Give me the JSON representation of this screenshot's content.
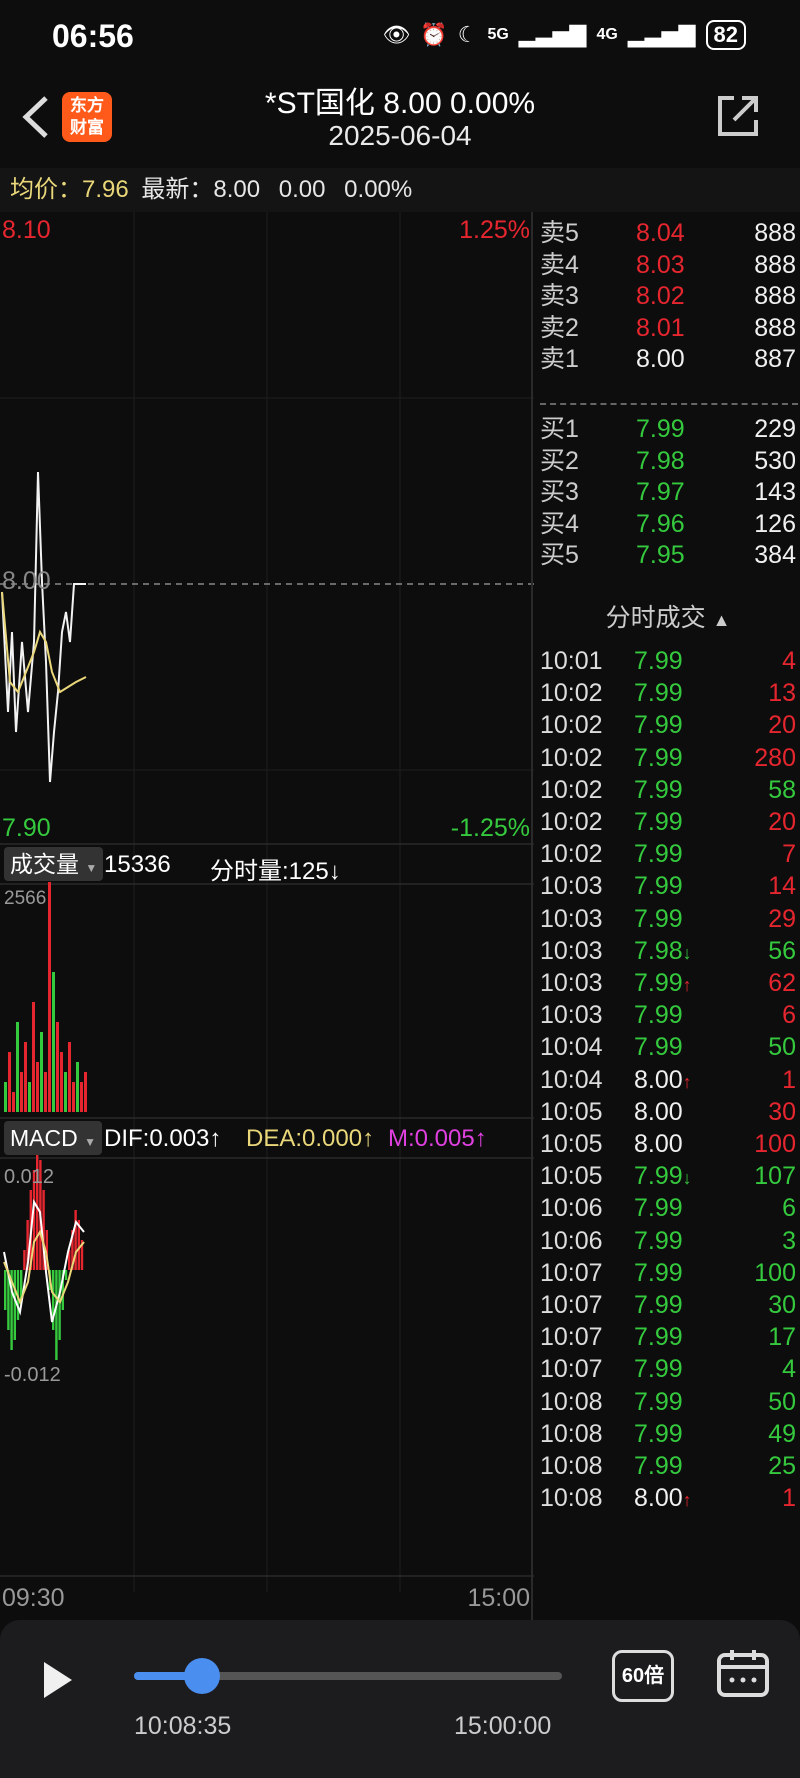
{
  "status_bar": {
    "time": "06:56",
    "net1": "5G",
    "net2": "4G",
    "battery": "82"
  },
  "header": {
    "title": "*ST国化  8.00  0.00%",
    "date": "2025-06-04",
    "logo_line1": "东方",
    "logo_line2": "财富"
  },
  "info": {
    "avg_label": "均价：",
    "avg_value": "7.96",
    "latest_label": "最新：",
    "latest_value": "8.00",
    "change": "0.00",
    "change_pct": "0.00%"
  },
  "chart": {
    "price_high": "8.10",
    "pct_high": "1.25%",
    "price_low": "7.90",
    "pct_low": "-1.25%",
    "price_ref": "8.00",
    "volume_dropdown": "成交量",
    "volume_total": "15336",
    "volume_minute": "分时量:125",
    "volume_max": "2566",
    "macd_dropdown": "MACD",
    "dif": "DIF:0.003",
    "dea": "DEA:0.000",
    "m": "M:0.005",
    "macd_max": "0.012",
    "macd_min": "-0.012",
    "time_start": "09:30",
    "time_end": "15:00",
    "colors": {
      "up": "#e6262f",
      "down": "#35c93e",
      "dif": "#ffffff",
      "dea": "#e9d77a",
      "m": "#e040e0"
    }
  },
  "order_book": {
    "asks": [
      {
        "label": "卖5",
        "price": "8.04",
        "volume": "888"
      },
      {
        "label": "卖4",
        "price": "8.03",
        "volume": "888"
      },
      {
        "label": "卖3",
        "price": "8.02",
        "volume": "888"
      },
      {
        "label": "卖2",
        "price": "8.01",
        "volume": "888"
      },
      {
        "label": "卖1",
        "price": "8.00",
        "volume": "887"
      }
    ],
    "bids": [
      {
        "label": "买1",
        "price": "7.99",
        "volume": "229"
      },
      {
        "label": "买2",
        "price": "7.98",
        "volume": "530"
      },
      {
        "label": "买3",
        "price": "7.97",
        "volume": "143"
      },
      {
        "label": "买4",
        "price": "7.96",
        "volume": "126"
      },
      {
        "label": "买5",
        "price": "7.95",
        "volume": "384"
      }
    ]
  },
  "ticks_title": "分时成交",
  "ticks": [
    {
      "time": "10:01",
      "price": "7.99",
      "arrow": "",
      "volume": "4",
      "pc": "g",
      "vc": "r"
    },
    {
      "time": "10:02",
      "price": "7.99",
      "arrow": "",
      "volume": "13",
      "pc": "g",
      "vc": "r"
    },
    {
      "time": "10:02",
      "price": "7.99",
      "arrow": "",
      "volume": "20",
      "pc": "g",
      "vc": "r"
    },
    {
      "time": "10:02",
      "price": "7.99",
      "arrow": "",
      "volume": "280",
      "pc": "g",
      "vc": "r"
    },
    {
      "time": "10:02",
      "price": "7.99",
      "arrow": "",
      "volume": "58",
      "pc": "g",
      "vc": "g"
    },
    {
      "time": "10:02",
      "price": "7.99",
      "arrow": "",
      "volume": "20",
      "pc": "g",
      "vc": "r"
    },
    {
      "time": "10:02",
      "price": "7.99",
      "arrow": "",
      "volume": "7",
      "pc": "g",
      "vc": "r"
    },
    {
      "time": "10:03",
      "price": "7.99",
      "arrow": "",
      "volume": "14",
      "pc": "g",
      "vc": "r"
    },
    {
      "time": "10:03",
      "price": "7.99",
      "arrow": "",
      "volume": "29",
      "pc": "g",
      "vc": "r"
    },
    {
      "time": "10:03",
      "price": "7.98",
      "arrow": "↓",
      "volume": "56",
      "pc": "g",
      "vc": "g"
    },
    {
      "time": "10:03",
      "price": "7.99",
      "arrow": "↑",
      "volume": "62",
      "pc": "g",
      "vc": "r"
    },
    {
      "time": "10:03",
      "price": "7.99",
      "arrow": "",
      "volume": "6",
      "pc": "g",
      "vc": "r"
    },
    {
      "time": "10:04",
      "price": "7.99",
      "arrow": "",
      "volume": "50",
      "pc": "g",
      "vc": "g"
    },
    {
      "time": "10:04",
      "price": "8.00",
      "arrow": "↑",
      "volume": "1",
      "pc": "w",
      "vc": "r"
    },
    {
      "time": "10:05",
      "price": "8.00",
      "arrow": "",
      "volume": "30",
      "pc": "w",
      "vc": "r"
    },
    {
      "time": "10:05",
      "price": "8.00",
      "arrow": "",
      "volume": "100",
      "pc": "w",
      "vc": "r"
    },
    {
      "time": "10:05",
      "price": "7.99",
      "arrow": "↓",
      "volume": "107",
      "pc": "g",
      "vc": "g"
    },
    {
      "time": "10:06",
      "price": "7.99",
      "arrow": "",
      "volume": "6",
      "pc": "g",
      "vc": "g"
    },
    {
      "time": "10:06",
      "price": "7.99",
      "arrow": "",
      "volume": "3",
      "pc": "g",
      "vc": "g"
    },
    {
      "time": "10:07",
      "price": "7.99",
      "arrow": "",
      "volume": "100",
      "pc": "g",
      "vc": "g"
    },
    {
      "time": "10:07",
      "price": "7.99",
      "arrow": "",
      "volume": "30",
      "pc": "g",
      "vc": "g"
    },
    {
      "time": "10:07",
      "price": "7.99",
      "arrow": "",
      "volume": "17",
      "pc": "g",
      "vc": "g"
    },
    {
      "time": "10:07",
      "price": "7.99",
      "arrow": "",
      "volume": "4",
      "pc": "g",
      "vc": "g"
    },
    {
      "time": "10:08",
      "price": "7.99",
      "arrow": "",
      "volume": "50",
      "pc": "g",
      "vc": "g"
    },
    {
      "time": "10:08",
      "price": "7.99",
      "arrow": "",
      "volume": "49",
      "pc": "g",
      "vc": "g"
    },
    {
      "time": "10:08",
      "price": "7.99",
      "arrow": "",
      "volume": "25",
      "pc": "g",
      "vc": "g"
    },
    {
      "time": "10:08",
      "price": "8.00",
      "arrow": "↑",
      "volume": "1",
      "pc": "w",
      "vc": "r"
    }
  ],
  "playback": {
    "current_time": "10:08:35",
    "end_time": "15:00:00",
    "speed": "60倍",
    "progress": 0.16
  }
}
